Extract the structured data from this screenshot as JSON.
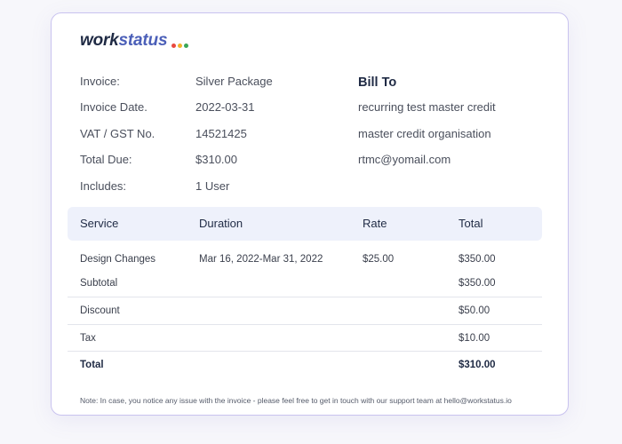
{
  "logo": {
    "part1": "work",
    "part2": "status",
    "dot_colors": [
      "#e94a3f",
      "#f2b32a",
      "#3aa757"
    ]
  },
  "invoice": {
    "rows": [
      {
        "label": "Invoice:",
        "value": "Silver Package"
      },
      {
        "label": "Invoice Date.",
        "value": "2022-03-31"
      },
      {
        "label": "VAT / GST No.",
        "value": "14521425"
      },
      {
        "label": "Total Due:",
        "value": "$310.00"
      },
      {
        "label": "Includes:",
        "value": "1 User"
      }
    ]
  },
  "bill_to": {
    "title": "Bill To",
    "lines": [
      "recurring test master credit",
      "master credit organisation",
      "rtmc@yomail.com"
    ]
  },
  "table": {
    "headers": [
      "Service",
      "Duration",
      "Rate",
      "Total"
    ],
    "item": {
      "service": "Design Changes",
      "duration": "Mar 16, 2022-Mar 31, 2022",
      "rate": "$25.00",
      "total": "$350.00"
    },
    "subtotal": {
      "label": "Subtotal",
      "value": "$350.00"
    },
    "discount": {
      "label": "Discount",
      "value": "$50.00"
    },
    "tax": {
      "label": "Tax",
      "value": "$10.00"
    },
    "total": {
      "label": "Total",
      "value": "$310.00"
    }
  },
  "note": "Note: In case, you notice any issue with the invoice - please feel free to get in touch with our support team at hello@workstatus.io",
  "colors": {
    "border": "#c9c3ef",
    "header_bg": "#eef1fb",
    "brand_dark": "#1f2a44",
    "brand_blue": "#4b5fb8"
  }
}
